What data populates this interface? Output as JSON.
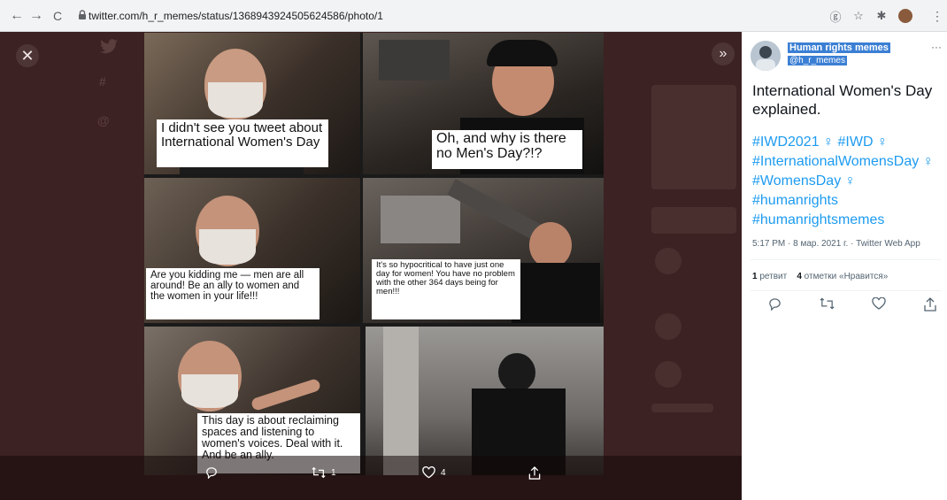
{
  "browser": {
    "url": "twitter.com/h_r_memes/status/1368943924505624586/photo/1",
    "back_icon": "←",
    "forward_icon": "→",
    "reload_icon": "C"
  },
  "overlay": {
    "close_icon": "✕",
    "next_icon": "»"
  },
  "meme": {
    "captions": [
      "I didn't see you tweet about International Women's Day",
      "Oh, and why is there no Men's Day?!?",
      "Are you kidding me — men are all around! Be an ally to women and the women in your life!!!",
      "It's so hypocritical to have just one day for women! You have no problem with the other 364 days being for men!!!",
      "This day is about reclaiming spaces and listening to women's voices. Deal with it. And be an ally."
    ]
  },
  "photo_actions": {
    "retweets": "1",
    "likes": "4"
  },
  "tweet": {
    "display_name": "Human rights memes",
    "handle": "@h_r_memes",
    "text": "International Women's Day explained.",
    "hashtags": [
      "#IWD2021",
      "#IWD",
      "#InternationalWomensDay",
      "#WomensDay",
      "#humanrights",
      "#humanrightsmemes"
    ],
    "meta": "5:17 PM · 8 мар. 2021 г. · Twitter Web App",
    "retweet_count": "1",
    "retweet_label": "ретвит",
    "like_count": "4",
    "like_label": "отметки «Нравится»"
  },
  "colors": {
    "accent": "#1d9bf0",
    "overlay_bg": "#3c2222",
    "selection": "#3b7fd4"
  }
}
